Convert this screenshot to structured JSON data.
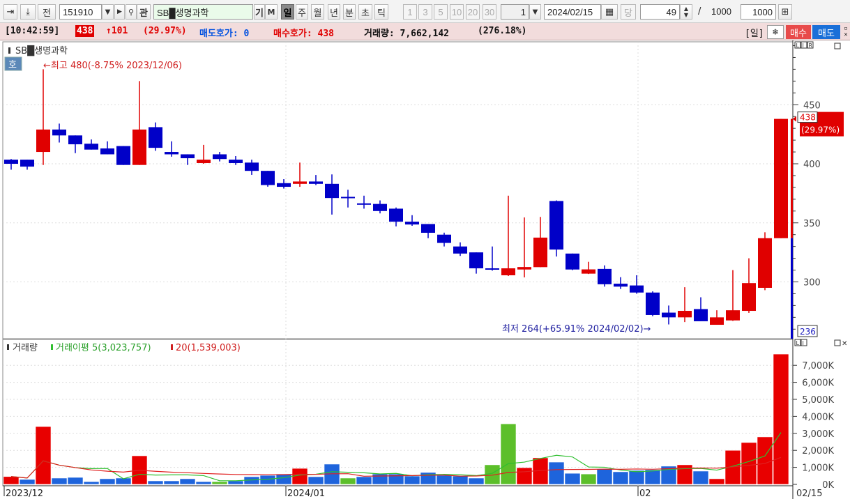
{
  "toolbar": {
    "prev_label": "전",
    "stock_code": "151910",
    "stock_name": "SB█생명과학",
    "gi_label": "기",
    "m_label": "M",
    "periods": [
      "일",
      "주",
      "월",
      "년",
      "분",
      "초",
      "틱"
    ],
    "selected_period": "일",
    "intervals": [
      "1",
      "3",
      "5",
      "10",
      "20",
      "30"
    ],
    "interval_value": "1",
    "date": "2024/02/15",
    "today_label": "당",
    "count": "49",
    "separator": "/",
    "total": "1000",
    "display_count": "1000",
    "search_label": "관"
  },
  "infobar": {
    "time": "[10:42:59]",
    "price": "438",
    "change": "↑101",
    "change_pct": "(29.97%)",
    "ask_label": "매도호가: 0",
    "bid_label": "매수호가: 438",
    "volume_label": "거래량: 7,662,142",
    "volume_pct": "(276.18%)",
    "period_tag": "[일]",
    "buy_label": "매수",
    "sell_label": "매도"
  },
  "colors": {
    "up": "#e00000",
    "down": "#0000c8",
    "vol_up": "#e80000",
    "vol_down": "#1e64dc",
    "vol_flat": "#5cbf2a",
    "ma5": "#2fbf2f",
    "ma20": "#e02020"
  },
  "chart_data": {
    "type": "candlestick",
    "title": "SB█생명과학",
    "hoga_label": "호",
    "max_annotation": "←최고 480(-8.75% 2023/12/06)",
    "min_annotation": "최저 264(+65.91% 2024/02/02)→",
    "price_ticks": [
      450,
      400,
      350,
      300
    ],
    "price_range": [
      252,
      502
    ],
    "current_price_tag": "438",
    "current_pct_tag": "(29.97%)",
    "low_tag": "236",
    "axis_buttons": [
      "L",
      "I",
      "R"
    ],
    "x_labels": [
      {
        "index": 0,
        "text": "2023/12"
      },
      {
        "index": 18,
        "text": "2024/01"
      },
      {
        "index": 40,
        "text": "02"
      }
    ],
    "last_date_label": "02/15",
    "candles": [
      [
        403.5,
        404,
        395,
        400
      ],
      [
        403.5,
        403.5,
        395,
        397.6
      ],
      [
        410,
        480,
        399,
        429
      ],
      [
        429,
        434,
        418,
        424
      ],
      [
        424,
        424,
        409,
        416.5
      ],
      [
        417,
        420.6,
        412,
        412
      ],
      [
        413,
        419,
        408,
        408
      ],
      [
        415,
        415,
        399,
        399
      ],
      [
        399,
        470,
        399,
        429
      ],
      [
        431,
        435,
        411,
        413.5
      ],
      [
        410,
        419,
        406,
        408
      ],
      [
        408,
        408,
        399,
        404.7
      ],
      [
        400.6,
        416,
        400,
        403.5
      ],
      [
        408,
        410,
        402,
        404
      ],
      [
        403.5,
        406.5,
        399,
        400.6
      ],
      [
        401,
        403.5,
        390.6,
        394
      ],
      [
        394,
        394,
        380.6,
        382
      ],
      [
        383.6,
        387,
        379,
        380.5
      ],
      [
        383,
        401,
        380.5,
        385
      ],
      [
        385,
        390.5,
        382,
        383
      ],
      [
        383,
        391,
        357,
        371
      ],
      [
        372,
        378,
        363,
        371.5
      ],
      [
        366.5,
        373,
        362,
        366
      ],
      [
        366,
        369,
        358,
        360
      ],
      [
        362,
        363,
        347,
        351
      ],
      [
        351,
        356.5,
        347.5,
        348.6
      ],
      [
        349,
        349,
        337,
        341.6
      ],
      [
        340,
        341.7,
        330,
        333
      ],
      [
        330,
        333.5,
        322,
        324
      ],
      [
        325,
        325,
        307,
        311.5
      ],
      [
        311.5,
        330,
        309.5,
        311
      ],
      [
        305.6,
        373,
        305,
        311.5
      ],
      [
        310.5,
        354.6,
        303.8,
        312.6
      ],
      [
        312.5,
        355,
        312.5,
        337.5
      ],
      [
        368.5,
        369,
        321.5,
        327.4
      ],
      [
        324,
        324,
        310,
        310.5
      ],
      [
        307,
        317,
        306.7,
        310.6
      ],
      [
        311,
        314,
        296,
        298
      ],
      [
        298.5,
        304,
        294,
        296
      ],
      [
        297,
        305.6,
        290,
        291
      ],
      [
        291,
        292,
        271,
        272
      ],
      [
        274,
        280,
        264,
        270
      ],
      [
        270,
        295.5,
        266,
        275.5
      ],
      [
        277,
        287,
        266.7,
        266.7
      ],
      [
        263.7,
        276,
        263.7,
        270
      ],
      [
        267.4,
        310,
        267,
        276
      ],
      [
        275.5,
        320,
        273.8,
        299
      ],
      [
        295,
        342,
        293,
        337
      ],
      [
        337,
        438,
        337,
        438
      ]
    ],
    "volume": {
      "title": "거래량",
      "ma5_label": "거래이평 5(3,023,757)",
      "ma20_label": "20(1,539,003)",
      "ticks": [
        "7,000K",
        "6,000K",
        "5,000K",
        "4,000K",
        "3,000K",
        "2,000K",
        "1,000K",
        "0K"
      ],
      "unit": "K",
      "values": [
        460,
        290,
        3400,
        370,
        410,
        160,
        330,
        370,
        1680,
        205,
        205,
        330,
        160,
        160,
        205,
        450,
        530,
        610,
        940,
        450,
        1190,
        370,
        450,
        610,
        610,
        490,
        700,
        530,
        490,
        370,
        1150,
        3560,
        980,
        1560,
        1310,
        650,
        610,
        900,
        740,
        820,
        860,
        1070,
        1150,
        780,
        330,
        2000,
        2460,
        2790,
        7662
      ],
      "colors": [
        "u",
        "d",
        "u",
        "d",
        "d",
        "d",
        "d",
        "d",
        "u",
        "d",
        "d",
        "d",
        "d",
        "f",
        "d",
        "d",
        "d",
        "d",
        "u",
        "d",
        "d",
        "f",
        "d",
        "d",
        "d",
        "d",
        "d",
        "d",
        "d",
        "d",
        "f",
        "f",
        "u",
        "u",
        "d",
        "d",
        "f",
        "d",
        "d",
        "d",
        "d",
        "d",
        "u",
        "d",
        "u",
        "u",
        "u",
        "u",
        "u"
      ]
    }
  }
}
